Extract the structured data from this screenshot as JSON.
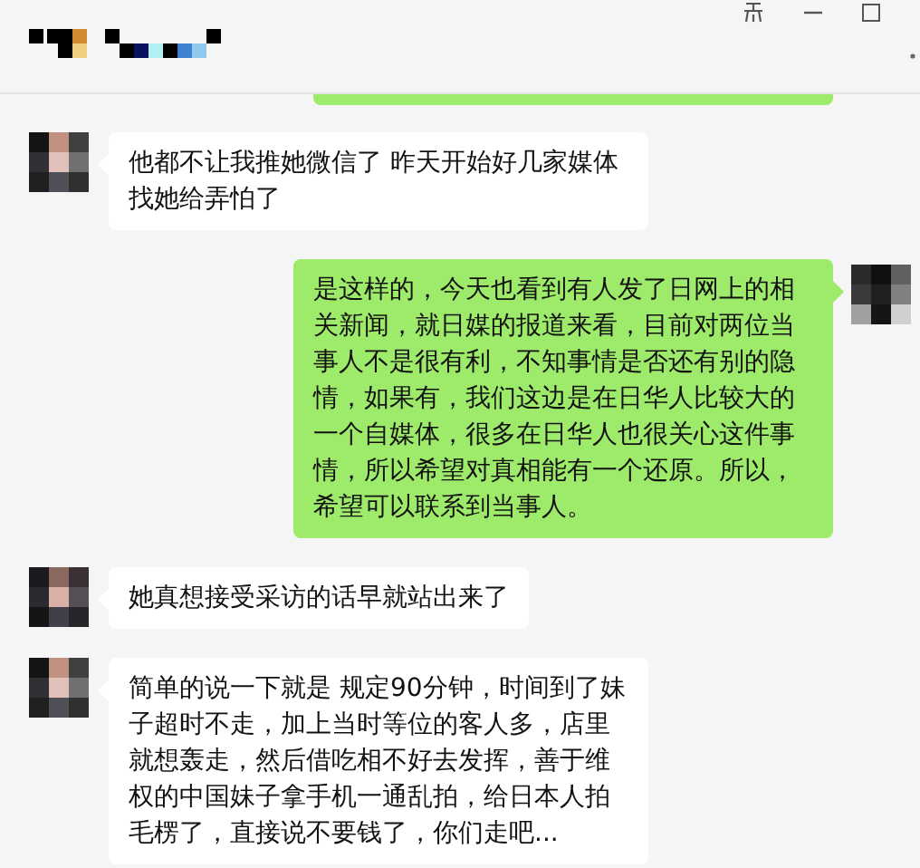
{
  "messages": [
    {
      "outgoing": true,
      "kind": "clipped"
    },
    {
      "outgoing": false,
      "kind": "text",
      "text": "他都不让我推她微信了 昨天开始好几家媒体找她给弄怕了"
    },
    {
      "outgoing": true,
      "kind": "text",
      "text": "是这样的，今天也看到有人发了日网上的相关新闻，就日媒的报道来看，目前对两位当事人不是很有利，不知事情是否还有别的隐情，如果有，我们这边是在日华人比较大的一个自媒体，很多在日华人也很关心这件事情，所以希望对真相能有一个还原。所以，希望可以联系到当事人。"
    },
    {
      "outgoing": false,
      "kind": "text",
      "text": "她真想接受采访的话早就站出来了"
    },
    {
      "outgoing": false,
      "kind": "text",
      "text": "简单的说一下就是 规定90分钟，时间到了妹子超时不走，加上当时等位的客人多，店里就想轰走，然后借吃相不好去发挥，善于维权的中国妹子拿手机一通乱拍，给日本人拍毛楞了，直接说不要钱了，你们走吧..."
    }
  ]
}
